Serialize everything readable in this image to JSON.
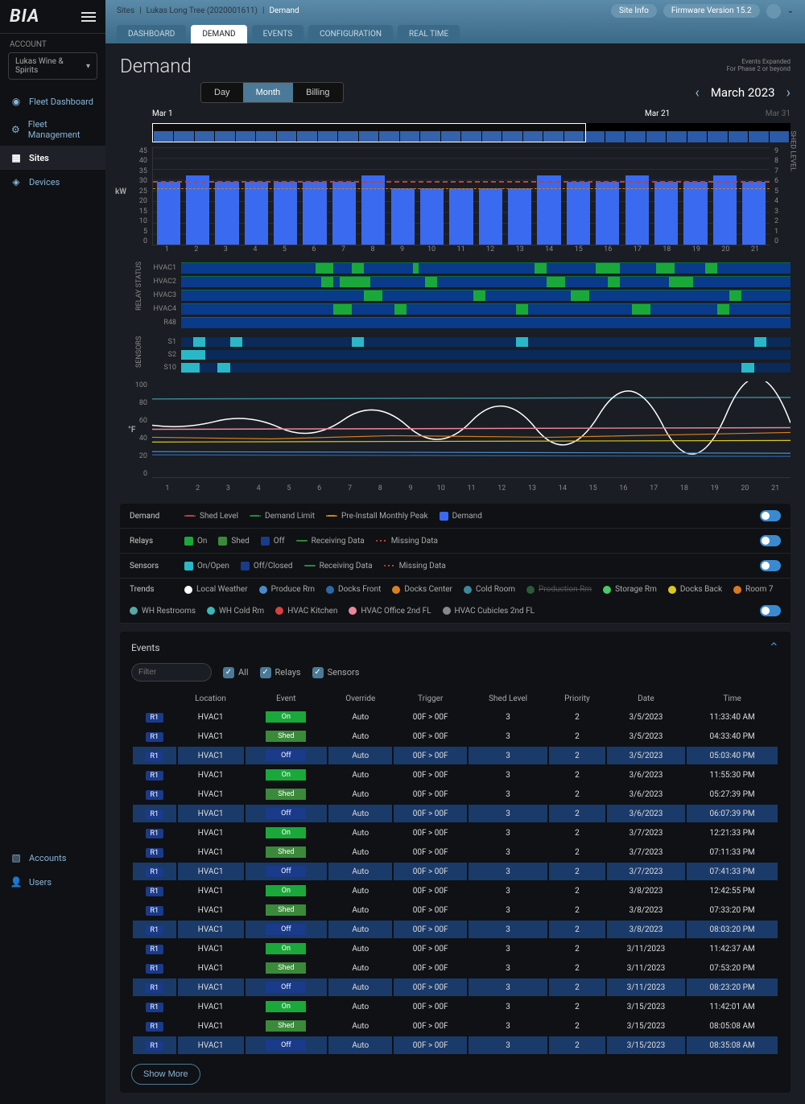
{
  "app": {
    "logo": "BIA"
  },
  "account": {
    "label": "ACCOUNT",
    "selected": "Lukas Wine & Spirits"
  },
  "nav": {
    "items": [
      {
        "label": "Fleet Dashboard",
        "icon": "◉"
      },
      {
        "label": "Fleet Management",
        "icon": "⚙"
      },
      {
        "label": "Sites",
        "icon": "▦",
        "active": true
      },
      {
        "label": "Devices",
        "icon": "◈"
      }
    ],
    "bottom": [
      {
        "label": "Accounts",
        "icon": "▧"
      },
      {
        "label": "Users",
        "icon": "👤"
      }
    ]
  },
  "breadcrumb": {
    "a": "Sites",
    "b": "Lukas Long Tree (2020001611)",
    "c": "Demand"
  },
  "header": {
    "site_info": "Site Info",
    "firmware": "Firmware Version 15.2"
  },
  "tabs": [
    "DASHBOARD",
    "DEMAND",
    "EVENTS",
    "CONFIGURATION",
    "REAL TIME"
  ],
  "tabs_active": "DEMAND",
  "page": {
    "title": "Demand",
    "meta1": "Events Expanded",
    "meta2": "For Phase 2 or beyond"
  },
  "period": {
    "day": "Day",
    "month": "Month",
    "billing": "Billing",
    "active": "Month",
    "label": "March 2023"
  },
  "minimap": {
    "start": "Mar 1",
    "cursor": "Mar 21",
    "end": "Mar 31"
  },
  "chart_data": {
    "type": "bar",
    "ylabel": "kW",
    "y2label": "SHED LEVEL",
    "y_ticks": [
      45,
      40,
      35,
      30,
      25,
      20,
      15,
      10,
      5,
      0
    ],
    "y2_ticks": [
      9,
      8,
      7,
      6,
      5,
      4,
      3,
      2,
      1,
      0
    ],
    "categories": [
      1,
      2,
      3,
      4,
      5,
      6,
      7,
      8,
      9,
      10,
      11,
      12,
      13,
      14,
      15,
      16,
      17,
      18,
      19,
      20,
      21
    ],
    "values": [
      29,
      32,
      29,
      29,
      29,
      29,
      29,
      32,
      26,
      26,
      26,
      26,
      26,
      32,
      29,
      29,
      32,
      29,
      29,
      32,
      29
    ],
    "ylim": [
      0,
      45
    ],
    "demand_limit": 30,
    "preinstall_peak": 26
  },
  "relays": {
    "label": "RELAY STATUS",
    "rows": [
      {
        "name": "HVAC1",
        "segs": [
          [
            22,
            3
          ],
          [
            28,
            2
          ],
          [
            38,
            1
          ],
          [
            58,
            2
          ],
          [
            68,
            4
          ],
          [
            78,
            3
          ],
          [
            86,
            2
          ]
        ]
      },
      {
        "name": "HVAC2",
        "segs": [
          [
            23,
            2
          ],
          [
            26,
            5
          ],
          [
            40,
            2
          ],
          [
            60,
            3
          ],
          [
            70,
            2
          ],
          [
            80,
            4
          ]
        ]
      },
      {
        "name": "HVAC3",
        "segs": [
          [
            30,
            3
          ],
          [
            48,
            2
          ],
          [
            64,
            3
          ],
          [
            90,
            2
          ]
        ]
      },
      {
        "name": "HVAC4",
        "segs": [
          [
            25,
            3
          ],
          [
            35,
            2
          ],
          [
            55,
            2
          ],
          [
            74,
            3
          ],
          [
            88,
            2
          ]
        ]
      },
      {
        "name": "R48",
        "segs": []
      }
    ]
  },
  "sensors": {
    "label": "SENSORS",
    "rows": [
      {
        "name": "S1",
        "segs": [
          [
            2,
            2
          ],
          [
            8,
            2
          ],
          [
            28,
            2
          ],
          [
            55,
            2
          ],
          [
            94,
            2
          ]
        ]
      },
      {
        "name": "S2",
        "segs": [
          [
            0,
            4
          ]
        ]
      },
      {
        "name": "S10",
        "segs": [
          [
            0,
            3
          ],
          [
            6,
            2
          ],
          [
            92,
            2
          ]
        ]
      }
    ]
  },
  "temp": {
    "label": "°F",
    "y_ticks": [
      100,
      80,
      60,
      40,
      20,
      0
    ]
  },
  "legends": {
    "demand": {
      "title": "Demand",
      "items": [
        {
          "label": "Shed Level",
          "color": "#c04040",
          "shape": "dash"
        },
        {
          "label": "Demand Limit",
          "color": "#2a8a3a",
          "shape": "dash"
        },
        {
          "label": "Pre-Install Monthly Peak",
          "color": "#d88020",
          "shape": "dash"
        },
        {
          "label": "Demand",
          "color": "#3a6af0",
          "shape": "sq"
        }
      ]
    },
    "relays": {
      "title": "Relays",
      "items": [
        {
          "label": "On",
          "color": "#1aa83a",
          "shape": "sq"
        },
        {
          "label": "Shed",
          "color": "#3a8a3a",
          "shape": "sq"
        },
        {
          "label": "Off",
          "color": "#1a3a8a",
          "shape": "sq"
        },
        {
          "label": "Receiving Data",
          "color": "#2a8a3a",
          "shape": "line"
        },
        {
          "label": "Missing Data",
          "color": "#c04040",
          "shape": "dots"
        }
      ]
    },
    "sensors": {
      "title": "Sensors",
      "items": [
        {
          "label": "On/Open",
          "color": "#2ab8c8",
          "shape": "sq"
        },
        {
          "label": "Off/Closed",
          "color": "#1a3a8a",
          "shape": "sq"
        },
        {
          "label": "Receiving Data",
          "color": "#2a8a3a",
          "shape": "line"
        },
        {
          "label": "Missing Data",
          "color": "#c04040",
          "shape": "dots"
        }
      ]
    },
    "trends": {
      "title": "Trends",
      "items": [
        {
          "label": "Local Weather",
          "color": "#fff"
        },
        {
          "label": "Produce Rm",
          "color": "#4a8ac8"
        },
        {
          "label": "Docks Front",
          "color": "#2a68a8"
        },
        {
          "label": "Docks Center",
          "color": "#d88020"
        },
        {
          "label": "Cold Room",
          "color": "#3a8a9a"
        },
        {
          "label": "Production Rm",
          "color": "#2a5a3a",
          "strike": true
        },
        {
          "label": "Storage Rm",
          "color": "#4ac86a"
        },
        {
          "label": "Docks Back",
          "color": "#d8c820"
        },
        {
          "label": "Room 7",
          "color": "#d87820"
        },
        {
          "label": "WH Restrooms",
          "color": "#58a8a8"
        },
        {
          "label": "WH Cold Rm",
          "color": "#3ab8b8"
        },
        {
          "label": "HVAC Kitchen",
          "color": "#d84040"
        },
        {
          "label": "HVAC Office 2nd FL",
          "color": "#e8889a"
        },
        {
          "label": "HVAC Cubicles 2nd FL",
          "color": "#888"
        }
      ]
    }
  },
  "events": {
    "title": "Events",
    "filter_placeholder": "Filter",
    "chk_all": "All",
    "chk_relays": "Relays",
    "chk_sensors": "Sensors",
    "cols": [
      "",
      "Location",
      "Event",
      "Override",
      "Trigger",
      "Shed Level",
      "Priority",
      "Date",
      "Time"
    ],
    "rows": [
      [
        "R1",
        "HVAC1",
        "On",
        "Auto",
        "00F > 00F",
        "3",
        "2",
        "3/5/2023",
        "11:33:40 AM",
        false
      ],
      [
        "R1",
        "HVAC1",
        "Shed",
        "Auto",
        "00F > 00F",
        "3",
        "2",
        "3/5/2023",
        "04:33:40 PM",
        false
      ],
      [
        "R1",
        "HVAC1",
        "Off",
        "Auto",
        "00F > 00F",
        "3",
        "2",
        "3/5/2023",
        "05:03:40 PM",
        true
      ],
      [
        "R1",
        "HVAC1",
        "On",
        "Auto",
        "00F > 00F",
        "3",
        "2",
        "3/6/2023",
        "11:55:30 PM",
        false
      ],
      [
        "R1",
        "HVAC1",
        "Shed",
        "Auto",
        "00F > 00F",
        "3",
        "2",
        "3/6/2023",
        "05:27:39 PM",
        false
      ],
      [
        "R1",
        "HVAC1",
        "Off",
        "Auto",
        "00F > 00F",
        "3",
        "2",
        "3/6/2023",
        "06:07:39 PM",
        true
      ],
      [
        "R1",
        "HVAC1",
        "On",
        "Auto",
        "00F > 00F",
        "3",
        "2",
        "3/7/2023",
        "12:21:33 PM",
        false
      ],
      [
        "R1",
        "HVAC1",
        "Shed",
        "Auto",
        "00F > 00F",
        "3",
        "2",
        "3/7/2023",
        "07:11:33 PM",
        false
      ],
      [
        "R1",
        "HVAC1",
        "Off",
        "Auto",
        "00F > 00F",
        "3",
        "2",
        "3/7/2023",
        "07:41:33 PM",
        true
      ],
      [
        "R1",
        "HVAC1",
        "On",
        "Auto",
        "00F > 00F",
        "3",
        "2",
        "3/8/2023",
        "12:42:55 PM",
        false
      ],
      [
        "R1",
        "HVAC1",
        "Shed",
        "Auto",
        "00F > 00F",
        "3",
        "2",
        "3/8/2023",
        "07:33:20 PM",
        false
      ],
      [
        "R1",
        "HVAC1",
        "Off",
        "Auto",
        "00F > 00F",
        "3",
        "2",
        "3/8/2023",
        "08:03:20 PM",
        true
      ],
      [
        "R1",
        "HVAC1",
        "On",
        "Auto",
        "00F > 00F",
        "3",
        "2",
        "3/11/2023",
        "11:42:37 AM",
        false
      ],
      [
        "R1",
        "HVAC1",
        "Shed",
        "Auto",
        "00F > 00F",
        "3",
        "2",
        "3/11/2023",
        "07:53:20 PM",
        false
      ],
      [
        "R1",
        "HVAC1",
        "Off",
        "Auto",
        "00F > 00F",
        "3",
        "2",
        "3/11/2023",
        "08:23:20 PM",
        true
      ],
      [
        "R1",
        "HVAC1",
        "On",
        "Auto",
        "00F > 00F",
        "3",
        "2",
        "3/15/2023",
        "11:42:01 AM",
        false
      ],
      [
        "R1",
        "HVAC1",
        "Shed",
        "Auto",
        "00F > 00F",
        "3",
        "2",
        "3/15/2023",
        "08:05:08 AM",
        false
      ],
      [
        "R1",
        "HVAC1",
        "Off",
        "Auto",
        "00F > 00F",
        "3",
        "2",
        "3/15/2023",
        "08:35:08 AM",
        true
      ]
    ],
    "show_more": "Show More"
  }
}
